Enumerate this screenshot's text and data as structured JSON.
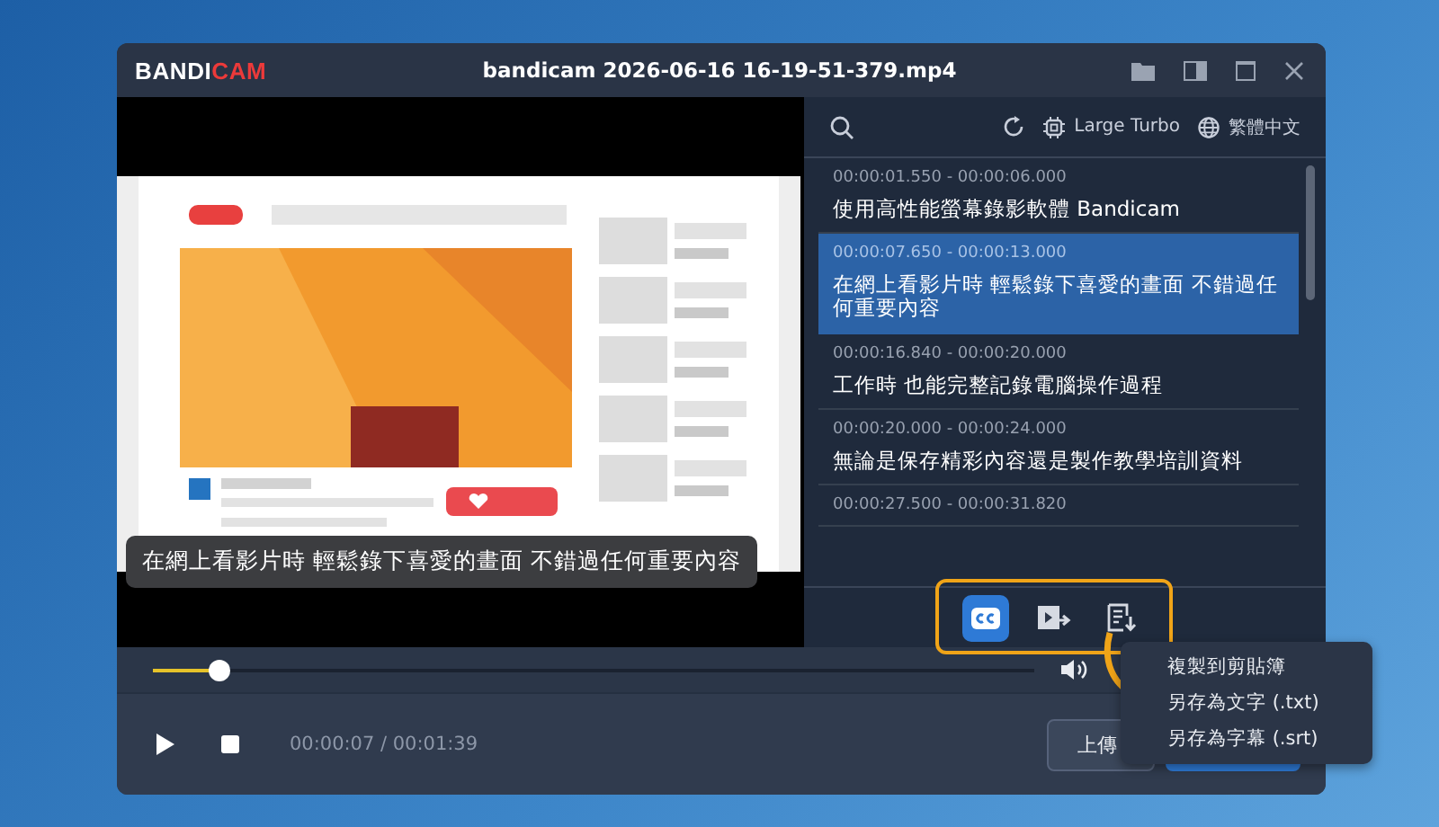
{
  "window": {
    "logo": [
      "BANDI",
      "CAM"
    ],
    "title": "bandicam 2026-06-16 16-19-51-379.mp4"
  },
  "player": {
    "caption": "在網上看影片時 輕鬆錄下喜愛的畫面 不錯過任何重要內容",
    "seek": {
      "level": 0.075
    },
    "time": "00:00:07 / 00:01:39"
  },
  "toolbar": {
    "model": "Large Turbo",
    "language": "繁體中文"
  },
  "subtitles": [
    {
      "time": "00:00:01.550 - 00:00:06.000",
      "text": "使用高性能螢幕錄影軟體 Bandicam",
      "selected": false
    },
    {
      "time": "00:00:07.650 - 00:00:13.000",
      "text": "在網上看影片時 輕鬆錄下喜愛的畫面 不錯過任何重要內容",
      "selected": true
    },
    {
      "time": "00:00:16.840 - 00:00:20.000",
      "text": "工作時 也能完整記錄電腦操作過程",
      "selected": false
    },
    {
      "time": "00:00:20.000 - 00:00:24.000",
      "text": "無論是保存精彩內容還是製作教學培訓資料",
      "selected": false
    },
    {
      "time": "00:00:27.500 - 00:00:31.820",
      "selected": false
    }
  ],
  "actions": [
    {
      "kind": "cc",
      "selected": true
    },
    {
      "kind": "export",
      "selected": false
    },
    {
      "kind": "save",
      "selected": false
    }
  ],
  "menu": [
    "複製到剪貼簿",
    "另存為文字 (.txt)",
    "另存為字幕 (.srt)"
  ],
  "buttons": [
    "上傳"
  ]
}
